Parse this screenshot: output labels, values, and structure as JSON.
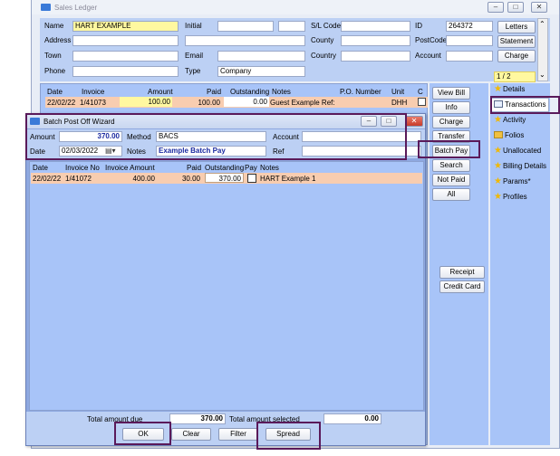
{
  "ledger": {
    "title": "Sales Ledger",
    "labels": {
      "name": "Name",
      "address": "Address",
      "town": "Town",
      "phone": "Phone",
      "initial": "Initial",
      "email": "Email",
      "type": "Type",
      "sl_code": "S/L Code",
      "county": "County",
      "country": "Country",
      "id": "ID",
      "postcode": "PostCode",
      "account": "Account"
    },
    "values": {
      "name": "HART EXAMPLE",
      "type": "Company",
      "id": "264372"
    },
    "right_buttons": {
      "letters": "Letters",
      "statement": "Statement",
      "charge": "Charge"
    },
    "page_indicator": "1 / 2",
    "table": {
      "headers": [
        "Date",
        "Invoice",
        "Amount",
        "Paid",
        "Outstanding",
        "Notes",
        "P.O. Number",
        "Unit",
        "C"
      ],
      "row": {
        "date": "22/02/22",
        "invoice": "1/41073",
        "amount": "100.00",
        "paid": "100.00",
        "outstanding": "0.00",
        "notes": "Guest Example  Ref:",
        "unit": "DHH"
      }
    },
    "action_buttons": [
      "View Bill",
      "Info",
      "Charge",
      "Transfer",
      "Batch Pay",
      "Search",
      "Not Paid",
      "All"
    ],
    "lower_buttons": [
      "Receipt",
      "Credit Card"
    ],
    "side_menu": [
      "Details",
      "Transactions",
      "Activity",
      "Folios",
      "Unallocated",
      "Billing Details",
      "Params*",
      "Profiles"
    ]
  },
  "wizard": {
    "title": "Batch Post Off Wizard",
    "labels": {
      "amount": "Amount",
      "method": "Method",
      "account": "Account",
      "date": "Date",
      "notes": "Notes",
      "ref": "Ref"
    },
    "values": {
      "amount": "370.00",
      "method": "BACS",
      "date": "02/03/2022",
      "notes": "Example Batch Pay"
    },
    "table": {
      "headers": [
        "Date",
        "Invoice No",
        "Invoice Amount",
        "Paid",
        "Outstanding",
        "Pay",
        "Notes"
      ],
      "row": {
        "date": "22/02/22",
        "invoice": "1/41072",
        "amount": "400.00",
        "paid": "30.00",
        "outstanding": "370.00",
        "notes": "HART Example 1"
      }
    },
    "footer": {
      "total_due_label": "Total amount due",
      "total_due": "370.00",
      "total_selected_label": "Total amount selected",
      "total_selected": "0.00"
    },
    "buttons": {
      "ok": "OK",
      "clear": "Clear",
      "filter": "Filter",
      "spread": "Spread"
    }
  },
  "colors": {
    "panel": "#bcd0f4",
    "grid": "#a8c4f8",
    "row": "#f8cdb0",
    "yellow": "#fff8a0",
    "highlight": "#5a1a5a"
  }
}
